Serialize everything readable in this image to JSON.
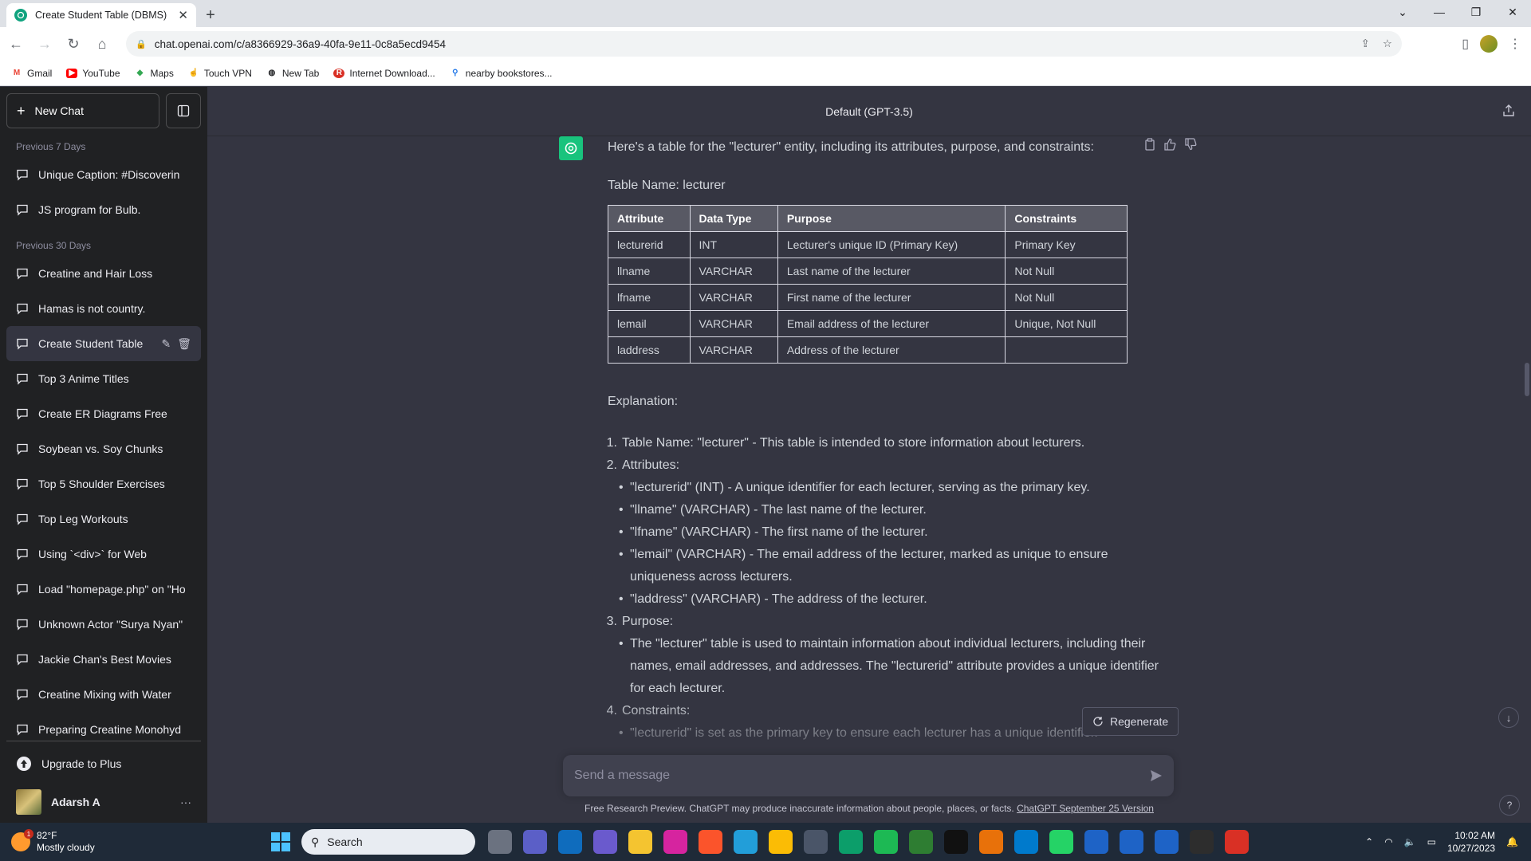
{
  "browser": {
    "tab_title": "Create Student Table (DBMS)",
    "url": "chat.openai.com/c/a8366929-36a9-40fa-9e11-0c8a5ecd9454",
    "bookmarks": [
      "Gmail",
      "YouTube",
      "Maps",
      "Touch VPN",
      "New Tab",
      "Internet Download...",
      "nearby bookstores..."
    ]
  },
  "sidebar": {
    "new_chat": "New Chat",
    "sections": [
      {
        "label": "Previous 7 Days",
        "items": [
          "Unique Caption: #Discoverin",
          "JS program for Bulb."
        ]
      },
      {
        "label": "Previous 30 Days",
        "items": [
          "Creatine and Hair Loss",
          "Hamas is not country.",
          "Create Student Table",
          "Top 3 Anime Titles",
          "Create ER Diagrams Free",
          "Soybean vs. Soy Chunks",
          "Top 5 Shoulder Exercises",
          "Top Leg Workouts",
          "Using `<div>` for Web",
          "Load \"homepage.php\" on \"Ho",
          "Unknown Actor \"Surya Nyan\"",
          "Jackie Chan's Best Movies",
          "Creatine Mixing with Water",
          "Preparing Creatine Monohyd"
        ]
      }
    ],
    "active_item": "Create Student Table",
    "upgrade": "Upgrade to Plus",
    "user_name": "Adarsh A"
  },
  "header": {
    "model": "Default (GPT-3.5)"
  },
  "message": {
    "intro": "Here's a table for the \"lecturer\" entity, including its attributes, purpose, and constraints:",
    "table_name": "Table Name: lecturer",
    "table": {
      "headers": [
        "Attribute",
        "Data Type",
        "Purpose",
        "Constraints"
      ],
      "rows": [
        [
          "lecturerid",
          "INT",
          "Lecturer's unique ID (Primary Key)",
          "Primary Key"
        ],
        [
          "llname",
          "VARCHAR",
          "Last name of the lecturer",
          "Not Null"
        ],
        [
          "lfname",
          "VARCHAR",
          "First name of the lecturer",
          "Not Null"
        ],
        [
          "lemail",
          "VARCHAR",
          "Email address of the lecturer",
          "Unique, Not Null"
        ],
        [
          "laddress",
          "VARCHAR",
          "Address of the lecturer",
          ""
        ]
      ]
    },
    "explanation_label": "Explanation:",
    "points": [
      {
        "num": "1.",
        "text": "Table Name: \"lecturer\" - This table is intended to store information about lecturers.",
        "subs": []
      },
      {
        "num": "2.",
        "text": "Attributes:",
        "subs": [
          "\"lecturerid\" (INT) - A unique identifier for each lecturer, serving as the primary key.",
          "\"llname\" (VARCHAR) - The last name of the lecturer.",
          "\"lfname\" (VARCHAR) - The first name of the lecturer.",
          "\"lemail\" (VARCHAR) - The email address of the lecturer, marked as unique to ensure uniqueness across lecturers.",
          "\"laddress\" (VARCHAR) - The address of the lecturer."
        ]
      },
      {
        "num": "3.",
        "text": "Purpose:",
        "subs": [
          "The \"lecturer\" table is used to maintain information about individual lecturers, including their names, email addresses, and addresses. The \"lecturerid\" attribute provides a unique identifier for each lecturer."
        ]
      },
      {
        "num": "4.",
        "text": "Constraints:",
        "subs": [
          "\"lecturerid\" is set as the primary key to ensure each lecturer has a unique identifier."
        ]
      }
    ]
  },
  "regenerate": "Regenerate",
  "input_placeholder": "Send a message",
  "footer": {
    "text": "Free Research Preview. ChatGPT may produce inaccurate information about people, places, or facts.",
    "link": "ChatGPT September 25 Version"
  },
  "taskbar": {
    "temperature": "82°F",
    "condition": "Mostly cloudy",
    "weather_badge": "1",
    "search": "Search",
    "time": "10:02 AM",
    "date": "10/27/2023"
  }
}
